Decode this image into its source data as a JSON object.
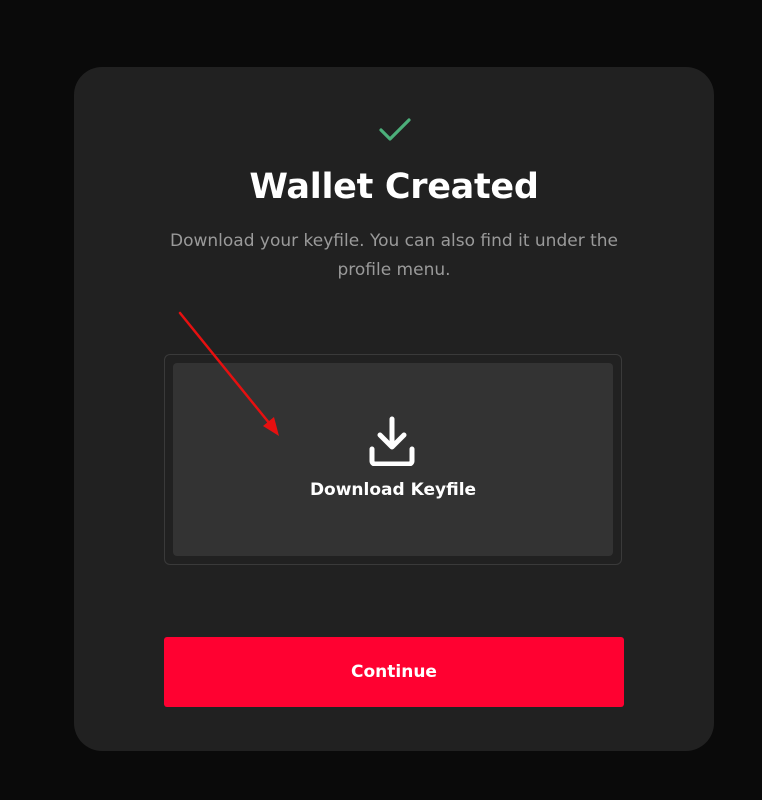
{
  "modal": {
    "status_icon": "checkmark-icon",
    "title": "Wallet Created",
    "subtitle": "Download your keyfile. You can also find it under the profile menu.",
    "download": {
      "icon": "download-icon",
      "label": "Download Keyfile"
    },
    "continue_label": "Continue"
  },
  "annotation": {
    "type": "arrow",
    "color": "#e61010"
  },
  "colors": {
    "modal_background": "#212121",
    "page_background": "#0a0a0a",
    "check": "#4caf7a",
    "accent": "#ff0131",
    "dropzone": "#333333"
  }
}
